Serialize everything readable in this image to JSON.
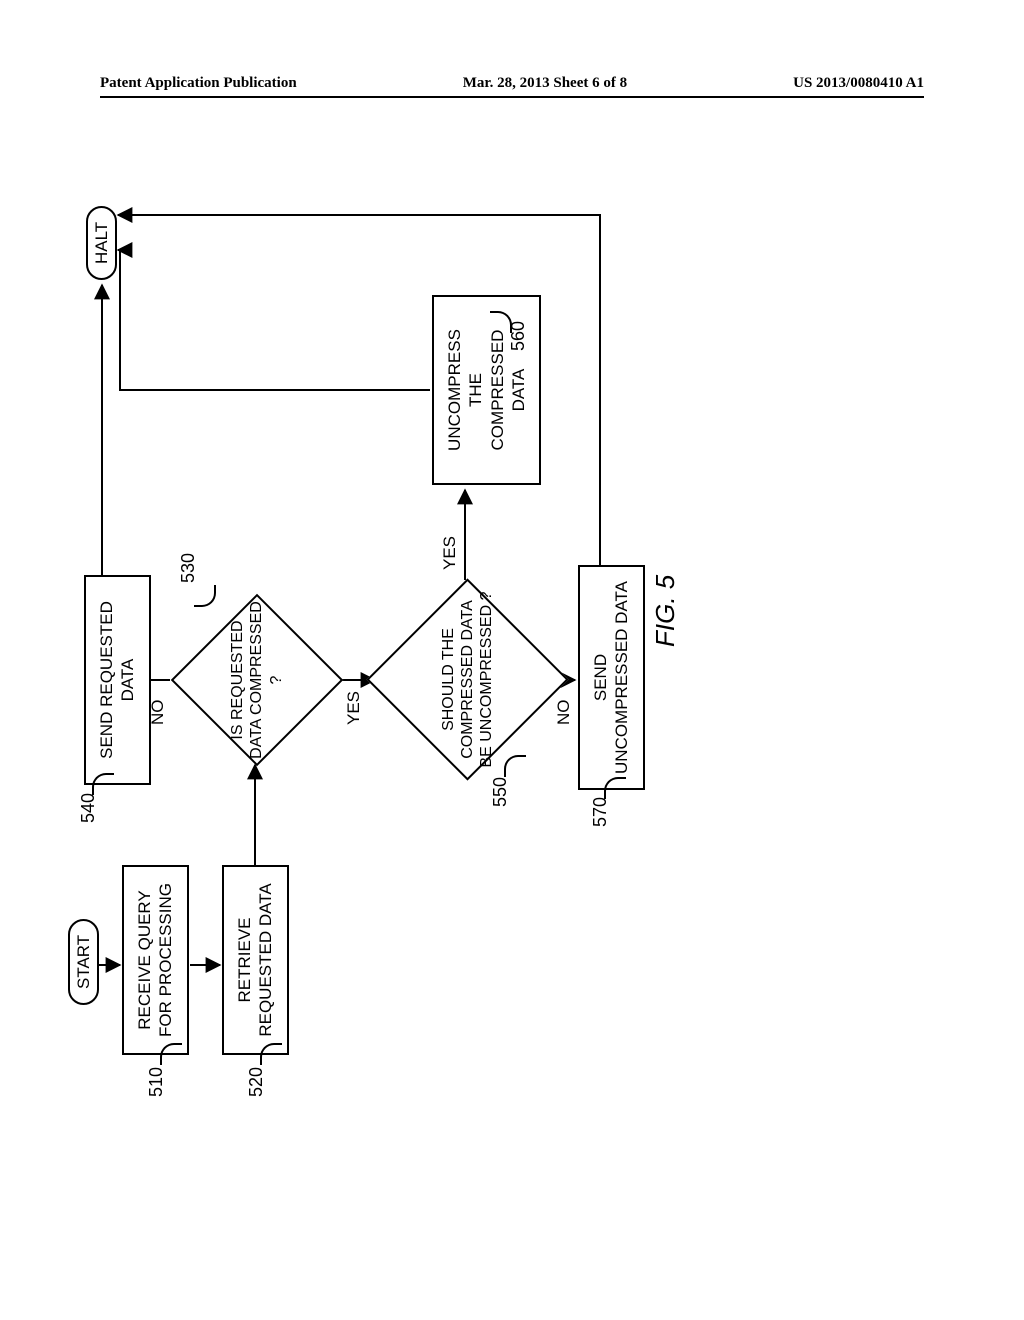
{
  "header": {
    "left": "Patent Application Publication",
    "center": "Mar. 28, 2013  Sheet 6 of 8",
    "right": "US 2013/0080410 A1"
  },
  "nodes": {
    "start": "START",
    "halt": "HALT",
    "step510": "RECEIVE QUERY FOR PROCESSING",
    "step520": "RETRIEVE REQUESTED DATA",
    "step540": "SEND REQUESTED DATA",
    "step560": "UNCOMPRESS THE COMPRESSED DATA",
    "step570": "SEND UNCOMPRESSED DATA",
    "dec530": "IS REQUESTED DATA COMPRESSED ?",
    "dec550": "SHOULD THE COMPRESSED DATA BE UNCOMPRESSED ?"
  },
  "refs": {
    "r510": "510",
    "r520": "520",
    "r530": "530",
    "r540": "540",
    "r550": "550",
    "r560": "560",
    "r570": "570"
  },
  "branches": {
    "no": "NO",
    "yes": "YES"
  },
  "figure": "FIG. 5"
}
